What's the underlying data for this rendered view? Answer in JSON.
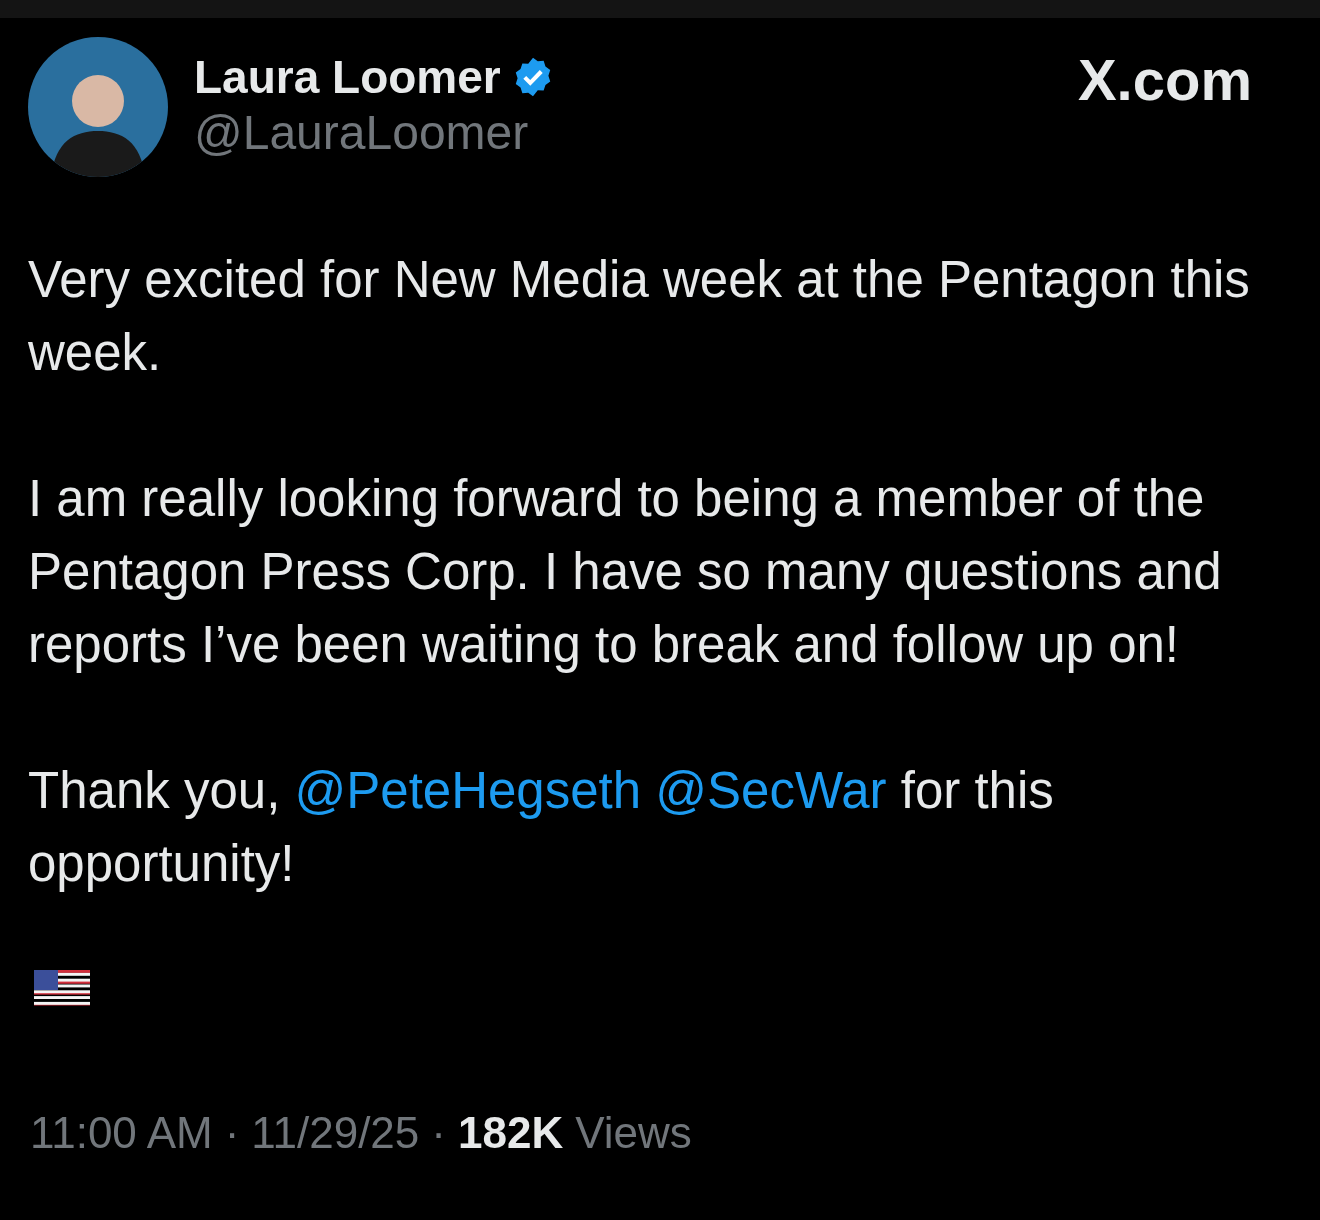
{
  "author": {
    "name": "Laura Loomer",
    "verified": true,
    "handle": "@LauraLoomer"
  },
  "site_label": "X.com",
  "paragraphs": [
    [
      {
        "kind": "text",
        "text": "Very excited for New Media week at the Pentagon this week."
      }
    ],
    [
      {
        "kind": "text",
        "text": "I am really looking forward to being a member of the Pentagon Press Corp. I have so many questions and reports I’ve been waiting to break and follow up on!"
      }
    ],
    [
      {
        "kind": "text",
        "text": "Thank you, "
      },
      {
        "kind": "mention",
        "text": "@PeteHegseth"
      },
      {
        "kind": "mention",
        "text": "@SecWar"
      },
      {
        "kind": "text",
        "text": " for this opportunity!"
      }
    ]
  ],
  "flag_emoji": true,
  "footer": {
    "time": "11:00 AM",
    "separator_1": "·",
    "date": "11/29/25",
    "separator_2": "·",
    "views_count": "182K",
    "views_label": "Views"
  }
}
